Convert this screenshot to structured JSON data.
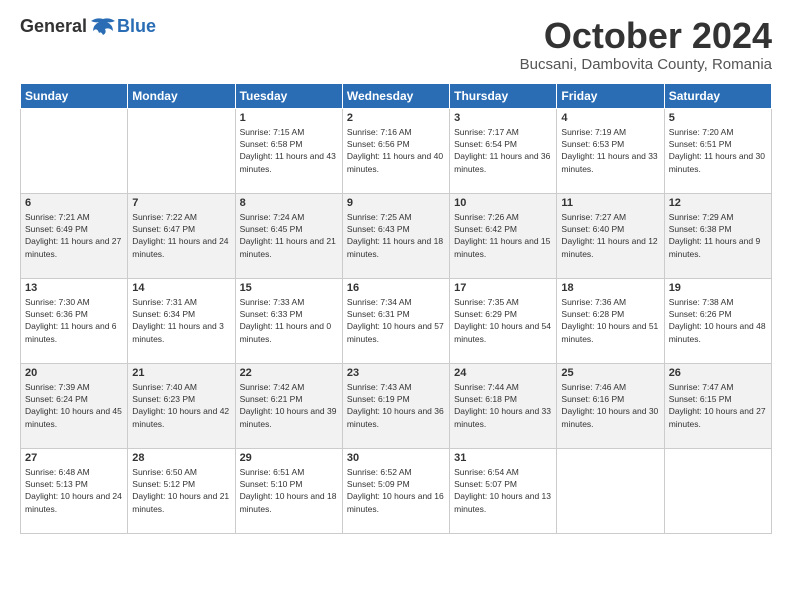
{
  "header": {
    "logo": {
      "general": "General",
      "blue": "Blue"
    },
    "title": "October 2024",
    "location": "Bucsani, Dambovita County, Romania"
  },
  "days_of_week": [
    "Sunday",
    "Monday",
    "Tuesday",
    "Wednesday",
    "Thursday",
    "Friday",
    "Saturday"
  ],
  "weeks": [
    [
      {
        "day": "",
        "sunrise": "",
        "sunset": "",
        "daylight": ""
      },
      {
        "day": "",
        "sunrise": "",
        "sunset": "",
        "daylight": ""
      },
      {
        "day": "1",
        "sunrise": "Sunrise: 7:15 AM",
        "sunset": "Sunset: 6:58 PM",
        "daylight": "Daylight: 11 hours and 43 minutes."
      },
      {
        "day": "2",
        "sunrise": "Sunrise: 7:16 AM",
        "sunset": "Sunset: 6:56 PM",
        "daylight": "Daylight: 11 hours and 40 minutes."
      },
      {
        "day": "3",
        "sunrise": "Sunrise: 7:17 AM",
        "sunset": "Sunset: 6:54 PM",
        "daylight": "Daylight: 11 hours and 36 minutes."
      },
      {
        "day": "4",
        "sunrise": "Sunrise: 7:19 AM",
        "sunset": "Sunset: 6:53 PM",
        "daylight": "Daylight: 11 hours and 33 minutes."
      },
      {
        "day": "5",
        "sunrise": "Sunrise: 7:20 AM",
        "sunset": "Sunset: 6:51 PM",
        "daylight": "Daylight: 11 hours and 30 minutes."
      }
    ],
    [
      {
        "day": "6",
        "sunrise": "Sunrise: 7:21 AM",
        "sunset": "Sunset: 6:49 PM",
        "daylight": "Daylight: 11 hours and 27 minutes."
      },
      {
        "day": "7",
        "sunrise": "Sunrise: 7:22 AM",
        "sunset": "Sunset: 6:47 PM",
        "daylight": "Daylight: 11 hours and 24 minutes."
      },
      {
        "day": "8",
        "sunrise": "Sunrise: 7:24 AM",
        "sunset": "Sunset: 6:45 PM",
        "daylight": "Daylight: 11 hours and 21 minutes."
      },
      {
        "day": "9",
        "sunrise": "Sunrise: 7:25 AM",
        "sunset": "Sunset: 6:43 PM",
        "daylight": "Daylight: 11 hours and 18 minutes."
      },
      {
        "day": "10",
        "sunrise": "Sunrise: 7:26 AM",
        "sunset": "Sunset: 6:42 PM",
        "daylight": "Daylight: 11 hours and 15 minutes."
      },
      {
        "day": "11",
        "sunrise": "Sunrise: 7:27 AM",
        "sunset": "Sunset: 6:40 PM",
        "daylight": "Daylight: 11 hours and 12 minutes."
      },
      {
        "day": "12",
        "sunrise": "Sunrise: 7:29 AM",
        "sunset": "Sunset: 6:38 PM",
        "daylight": "Daylight: 11 hours and 9 minutes."
      }
    ],
    [
      {
        "day": "13",
        "sunrise": "Sunrise: 7:30 AM",
        "sunset": "Sunset: 6:36 PM",
        "daylight": "Daylight: 11 hours and 6 minutes."
      },
      {
        "day": "14",
        "sunrise": "Sunrise: 7:31 AM",
        "sunset": "Sunset: 6:34 PM",
        "daylight": "Daylight: 11 hours and 3 minutes."
      },
      {
        "day": "15",
        "sunrise": "Sunrise: 7:33 AM",
        "sunset": "Sunset: 6:33 PM",
        "daylight": "Daylight: 11 hours and 0 minutes."
      },
      {
        "day": "16",
        "sunrise": "Sunrise: 7:34 AM",
        "sunset": "Sunset: 6:31 PM",
        "daylight": "Daylight: 10 hours and 57 minutes."
      },
      {
        "day": "17",
        "sunrise": "Sunrise: 7:35 AM",
        "sunset": "Sunset: 6:29 PM",
        "daylight": "Daylight: 10 hours and 54 minutes."
      },
      {
        "day": "18",
        "sunrise": "Sunrise: 7:36 AM",
        "sunset": "Sunset: 6:28 PM",
        "daylight": "Daylight: 10 hours and 51 minutes."
      },
      {
        "day": "19",
        "sunrise": "Sunrise: 7:38 AM",
        "sunset": "Sunset: 6:26 PM",
        "daylight": "Daylight: 10 hours and 48 minutes."
      }
    ],
    [
      {
        "day": "20",
        "sunrise": "Sunrise: 7:39 AM",
        "sunset": "Sunset: 6:24 PM",
        "daylight": "Daylight: 10 hours and 45 minutes."
      },
      {
        "day": "21",
        "sunrise": "Sunrise: 7:40 AM",
        "sunset": "Sunset: 6:23 PM",
        "daylight": "Daylight: 10 hours and 42 minutes."
      },
      {
        "day": "22",
        "sunrise": "Sunrise: 7:42 AM",
        "sunset": "Sunset: 6:21 PM",
        "daylight": "Daylight: 10 hours and 39 minutes."
      },
      {
        "day": "23",
        "sunrise": "Sunrise: 7:43 AM",
        "sunset": "Sunset: 6:19 PM",
        "daylight": "Daylight: 10 hours and 36 minutes."
      },
      {
        "day": "24",
        "sunrise": "Sunrise: 7:44 AM",
        "sunset": "Sunset: 6:18 PM",
        "daylight": "Daylight: 10 hours and 33 minutes."
      },
      {
        "day": "25",
        "sunrise": "Sunrise: 7:46 AM",
        "sunset": "Sunset: 6:16 PM",
        "daylight": "Daylight: 10 hours and 30 minutes."
      },
      {
        "day": "26",
        "sunrise": "Sunrise: 7:47 AM",
        "sunset": "Sunset: 6:15 PM",
        "daylight": "Daylight: 10 hours and 27 minutes."
      }
    ],
    [
      {
        "day": "27",
        "sunrise": "Sunrise: 6:48 AM",
        "sunset": "Sunset: 5:13 PM",
        "daylight": "Daylight: 10 hours and 24 minutes."
      },
      {
        "day": "28",
        "sunrise": "Sunrise: 6:50 AM",
        "sunset": "Sunset: 5:12 PM",
        "daylight": "Daylight: 10 hours and 21 minutes."
      },
      {
        "day": "29",
        "sunrise": "Sunrise: 6:51 AM",
        "sunset": "Sunset: 5:10 PM",
        "daylight": "Daylight: 10 hours and 18 minutes."
      },
      {
        "day": "30",
        "sunrise": "Sunrise: 6:52 AM",
        "sunset": "Sunset: 5:09 PM",
        "daylight": "Daylight: 10 hours and 16 minutes."
      },
      {
        "day": "31",
        "sunrise": "Sunrise: 6:54 AM",
        "sunset": "Sunset: 5:07 PM",
        "daylight": "Daylight: 10 hours and 13 minutes."
      },
      {
        "day": "",
        "sunrise": "",
        "sunset": "",
        "daylight": ""
      },
      {
        "day": "",
        "sunrise": "",
        "sunset": "",
        "daylight": ""
      }
    ]
  ]
}
